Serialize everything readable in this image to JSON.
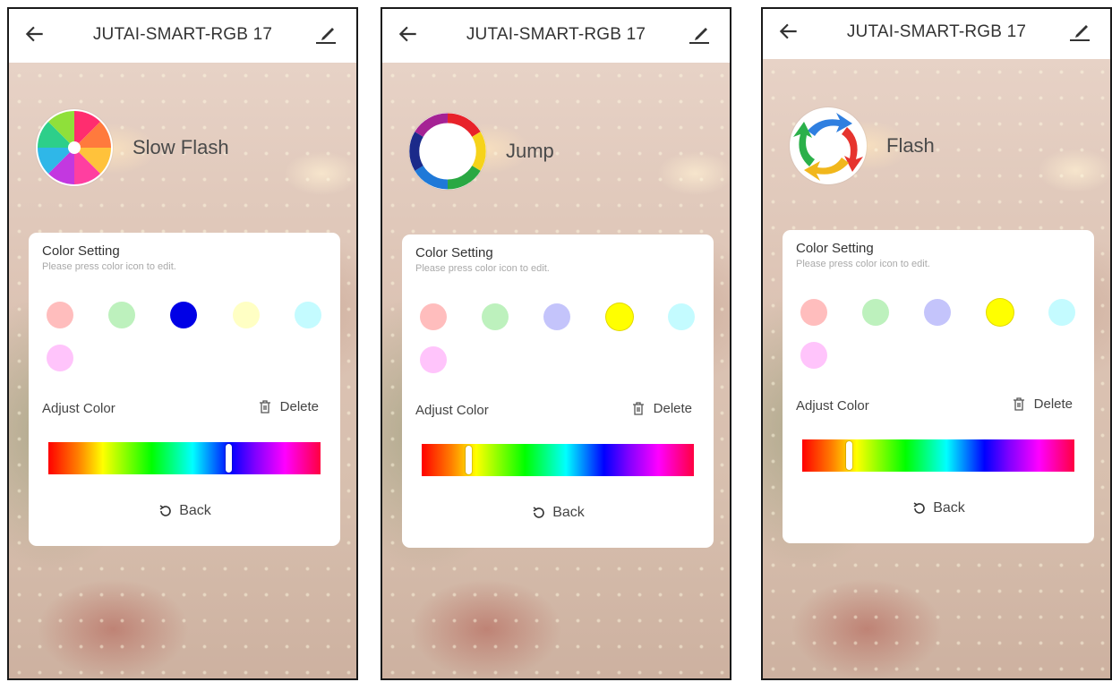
{
  "screens": [
    {
      "header": {
        "title": "JUTAI-SMART-RGB  17"
      },
      "mode": {
        "name": "Slow Flash",
        "icon": "slow-flash-swirl-icon"
      },
      "card": {
        "title": "Color Setting",
        "subtitle": "Please press color icon to edit.",
        "swatches": [
          "#ffbdbd",
          "#bdf1bd",
          "#0000e6",
          "#ffffc4",
          "#c4fbff",
          "#ffc4fb"
        ],
        "selected_swatch": "#0000e6",
        "adjust_label": "Adjust Color",
        "delete_label": "Delete",
        "hue_position": 0.66,
        "back_label": "Back"
      }
    },
    {
      "header": {
        "title": "JUTAI-SMART-RGB  17"
      },
      "mode": {
        "name": "Jump",
        "icon": "jump-ring-icon"
      },
      "card": {
        "title": "Color Setting",
        "subtitle": "Please press color icon to edit.",
        "swatches": [
          "#ffbdbd",
          "#bdf1bd",
          "#c4c4fb",
          "#ffff00",
          "#c4fbff",
          "#ffc4fb"
        ],
        "selected_swatch": "#ffff00",
        "adjust_label": "Adjust Color",
        "delete_label": "Delete",
        "hue_position": 0.17,
        "back_label": "Back"
      }
    },
    {
      "header": {
        "title": "JUTAI-SMART-RGB  17"
      },
      "mode": {
        "name": "Flash",
        "icon": "flash-arrows-icon"
      },
      "card": {
        "title": "Color Setting",
        "subtitle": "Please press color icon to edit.",
        "swatches": [
          "#ffbdbd",
          "#bdf1bd",
          "#c4c4fb",
          "#ffff00",
          "#c4fbff",
          "#ffc4fb"
        ],
        "selected_swatch": "#ffff00",
        "adjust_label": "Adjust Color",
        "delete_label": "Delete",
        "hue_position": 0.17,
        "back_label": "Back"
      }
    }
  ]
}
